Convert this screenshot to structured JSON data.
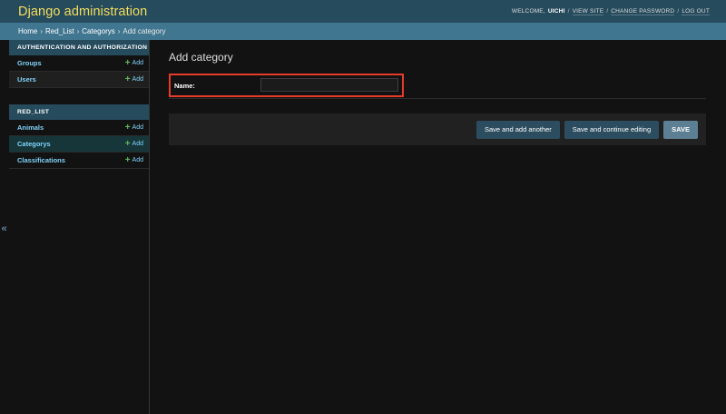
{
  "header": {
    "site_name": "Django administration",
    "welcome_prefix": "WELCOME,",
    "username": "UICHI",
    "links": [
      "VIEW SITE",
      "CHANGE PASSWORD",
      "LOG OUT"
    ],
    "separator": "/"
  },
  "breadcrumbs": {
    "items": [
      "Home",
      "Red_List",
      "Categorys",
      "Add category"
    ],
    "separator": "›"
  },
  "nav_toggle": "«",
  "sidebar": {
    "modules": [
      {
        "caption": "AUTHENTICATION AND AUTHORIZATION",
        "models": [
          {
            "name": "Groups",
            "add": "Add"
          },
          {
            "name": "Users",
            "add": "Add"
          }
        ]
      },
      {
        "caption": "RED_LIST",
        "models": [
          {
            "name": "Animals",
            "add": "Add"
          },
          {
            "name": "Categorys",
            "add": "Add"
          },
          {
            "name": "Classifications",
            "add": "Add"
          }
        ]
      }
    ]
  },
  "content": {
    "title": "Add category",
    "field_label": "Name:",
    "field_value": "",
    "buttons": {
      "save_add_another": "Save and add another",
      "save_continue": "Save and continue editing",
      "save": "SAVE"
    }
  },
  "colors": {
    "header_bg": "#264b5d",
    "breadcrumbs_bg": "#417690",
    "site_name": "#f5dd5d",
    "link": "#81d4fa",
    "highlight": "#e53b29",
    "background": "#121212"
  }
}
